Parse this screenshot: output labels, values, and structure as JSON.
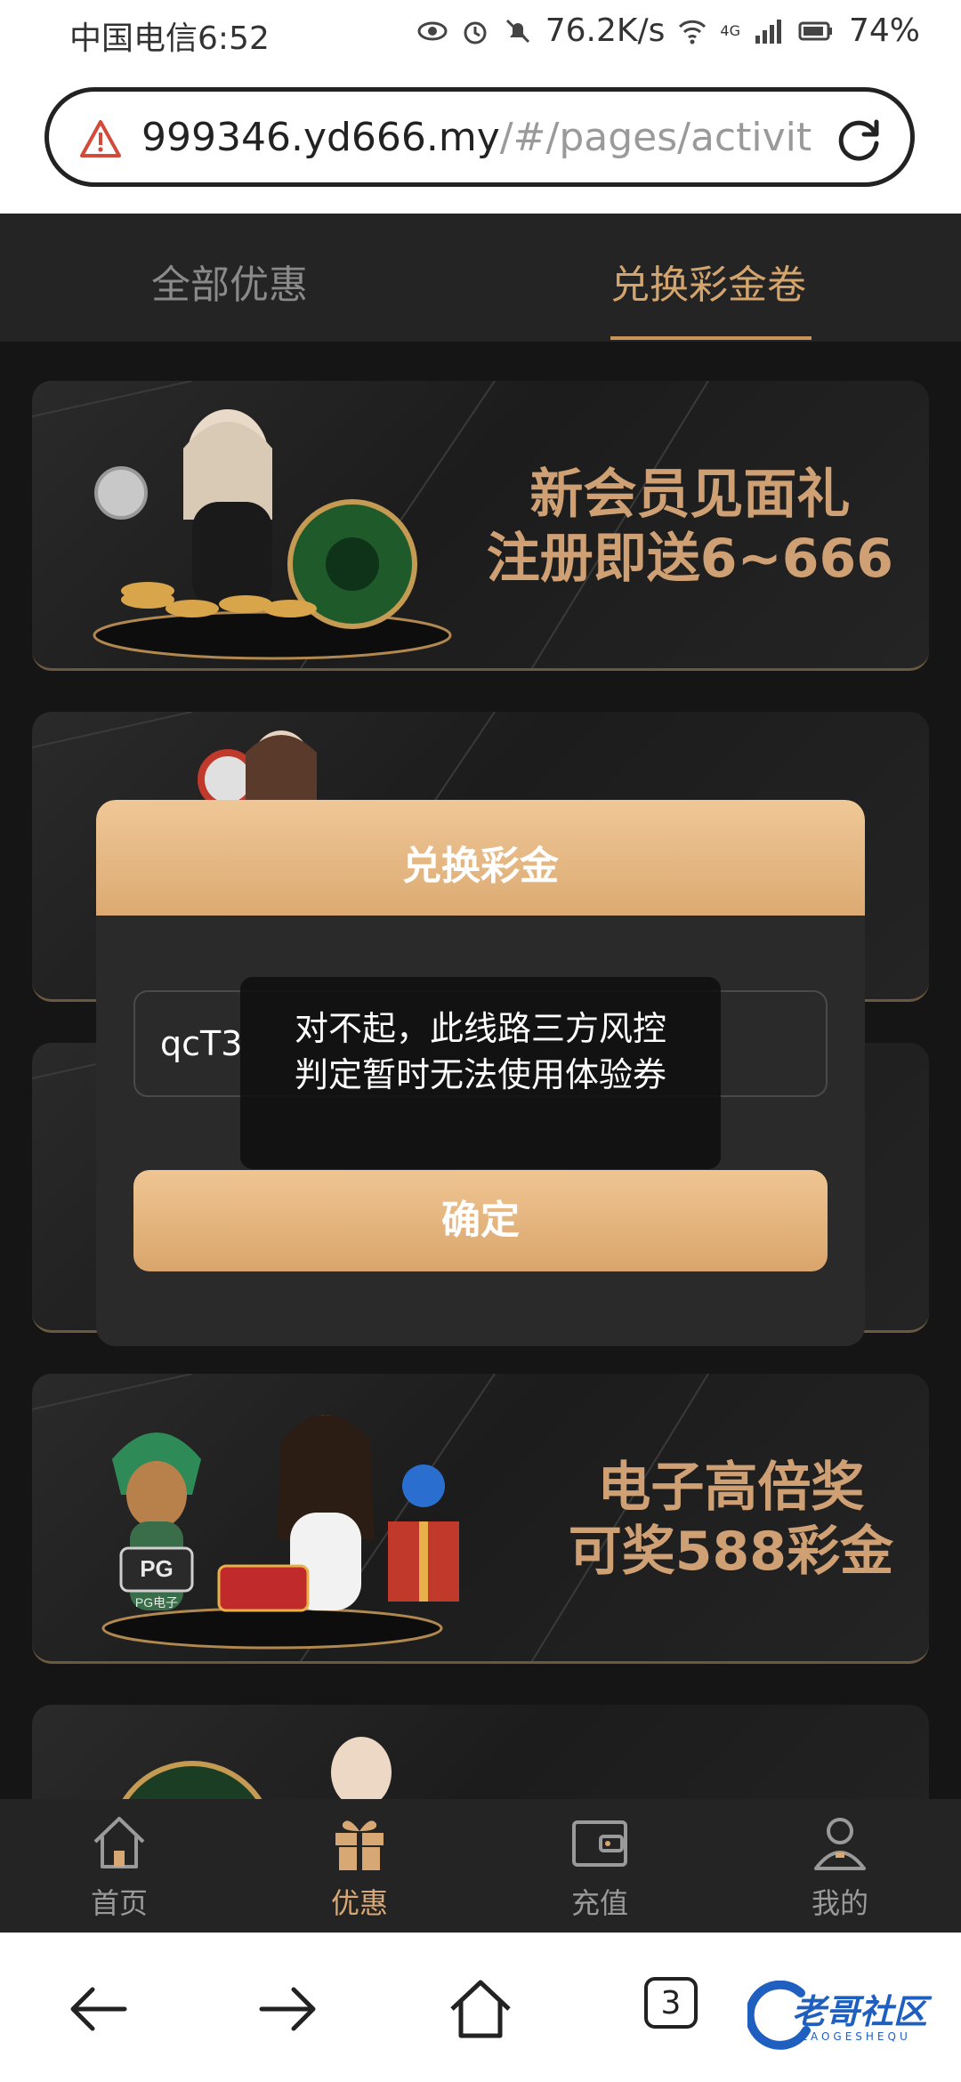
{
  "status_bar": {
    "carrier_time": "中国电信6:52",
    "net_speed": "76.2K/s",
    "network": "4G",
    "battery": "74%"
  },
  "address_bar": {
    "host": "999346.yd666.my",
    "path": "/#/pages/activit"
  },
  "tabs": [
    {
      "label": "全部优惠",
      "active": false
    },
    {
      "label": "兑换彩金卷",
      "active": true
    }
  ],
  "promos": [
    {
      "line1": "新会员见面礼",
      "line2": "注册即送6~666"
    },
    {
      "line1": "",
      "line2": ""
    },
    {
      "line1": "",
      "line2": ""
    },
    {
      "line1": "电子高倍奖",
      "line2": "可奖588彩金"
    },
    {
      "line1": "",
      "line2": ""
    }
  ],
  "card4_badge": "PG",
  "card4_badge_sub": "PG电子",
  "modal": {
    "title": "兑换彩金",
    "input_value": "qcT3",
    "confirm_label": "确定"
  },
  "toast": {
    "message": "对不起，此线路三方风控判定暂时无法使用体验券"
  },
  "bottom_nav": [
    {
      "label": "首页",
      "icon": "home-icon",
      "active": false
    },
    {
      "label": "优惠",
      "icon": "gift-icon",
      "active": true
    },
    {
      "label": "充值",
      "icon": "wallet-icon",
      "active": false
    },
    {
      "label": "我的",
      "icon": "user-icon",
      "active": false
    }
  ],
  "browser_nav": {
    "tab_count": "3"
  },
  "watermark": {
    "text": "老哥社区",
    "sub": "LAOGESHEQU"
  },
  "colors": {
    "accent": "#d3a46d",
    "background": "#151515",
    "modal_header": "#e8bb86"
  }
}
